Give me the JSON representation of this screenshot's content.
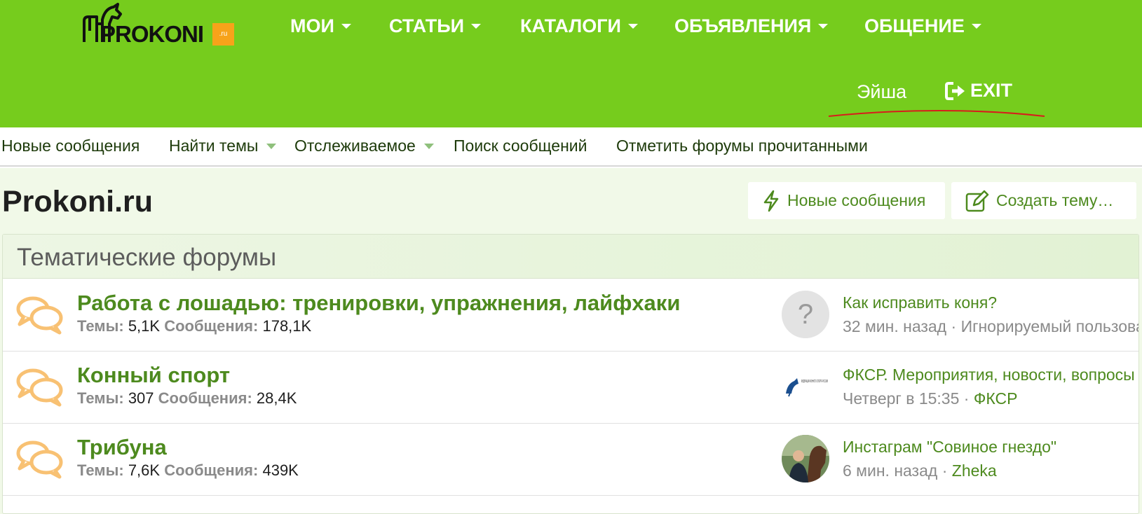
{
  "colors": {
    "header": "#76cc1d",
    "link": "#4d8a1e",
    "accent_orange": "#f7a31a",
    "forum_icon": "#f8c173"
  },
  "logo": {
    "brand": "PROKONI",
    "tld": ".ru"
  },
  "main_nav": [
    "МОИ",
    "СТАТЬИ",
    "КАТАЛОГИ",
    "ОБЪЯВЛЕНИЯ",
    "ОБЩЕНИЕ"
  ],
  "user": {
    "name": "Эйша",
    "exit_label": "EXIT"
  },
  "sub_nav": [
    "Новые сообщения",
    "Найти темы",
    "Отслеживаемое",
    "Поиск сообщений",
    "Отметить форумы прочитанными"
  ],
  "page": {
    "title": "Prokoni.ru",
    "new_posts_button": "Новые сообщения",
    "create_thread_button": "Создать тему…"
  },
  "category": {
    "title": "Тематические форумы"
  },
  "forums": [
    {
      "title": "Работа с лошадью: тренировки, упражнения, лайфхаки",
      "threads_label": "Темы:",
      "threads": "5,1K",
      "posts_label": "Сообщения:",
      "posts": "178,1K",
      "last_title": "Как исправить коня?",
      "last_time": "32 мин. назад",
      "last_user": "Игнорируемый пользователь",
      "avatar": "?"
    },
    {
      "title": "Конный спорт",
      "threads_label": "Темы:",
      "threads": "307",
      "posts_label": "Сообщения:",
      "posts": "28,4K",
      "last_title": "ФКСР. Мероприятия, новости, вопросы",
      "last_time": "Четверг в 15:35",
      "last_user": "ФКСР",
      "avatar": "ФЕДЕРАЦИЯ КОННОГО СПОРТА РОССИИ"
    },
    {
      "title": "Трибуна",
      "threads_label": "Темы:",
      "threads": "7,6K",
      "posts_label": "Сообщения:",
      "posts": "439K",
      "last_title": "Инстаграм \"Совиное гнездо\"",
      "last_time": "6 мин. назад",
      "last_user": "Zheka",
      "avatar": "photo"
    }
  ],
  "separator": "·"
}
